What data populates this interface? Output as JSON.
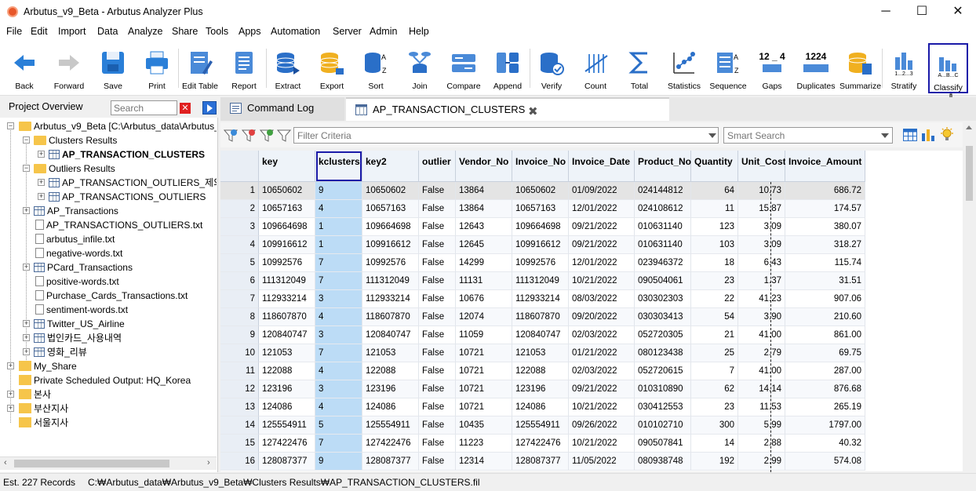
{
  "window": {
    "title": "Arbutus_v9_Beta - Arbutus Analyzer Plus",
    "minimize": "─",
    "maximize": "☐",
    "close": "✕"
  },
  "menu": [
    "File",
    "Edit",
    "Import",
    "Data",
    "Analyze",
    "Share",
    "Tools",
    "Apps",
    "Automation",
    "Server",
    "Admin",
    "Help"
  ],
  "toolbar": {
    "buttons": [
      {
        "label": "Back",
        "icon": "back-arrow-icon"
      },
      {
        "label": "Forward",
        "icon": "forward-arrow-icon"
      },
      {
        "label": "Save",
        "icon": "save-disk-icon"
      },
      {
        "label": "Print",
        "icon": "printer-icon"
      },
      {
        "label": "Edit Table",
        "icon": "edit-table-icon"
      },
      {
        "label": "Report",
        "icon": "report-icon"
      },
      {
        "label": "Extract",
        "icon": "extract-db-icon"
      },
      {
        "label": "Export",
        "icon": "export-db-icon"
      },
      {
        "label": "Sort",
        "icon": "sort-db-icon"
      },
      {
        "label": "Join",
        "icon": "join-icon"
      },
      {
        "label": "Compare",
        "icon": "compare-icon"
      },
      {
        "label": "Append",
        "icon": "append-icon"
      },
      {
        "label": "Verify",
        "icon": "verify-db-icon"
      },
      {
        "label": "Count",
        "icon": "count-icon"
      },
      {
        "label": "Total",
        "icon": "sigma-total-icon"
      },
      {
        "label": "Statistics",
        "icon": "statistics-icon"
      },
      {
        "label": "Sequence",
        "icon": "sequence-icon"
      },
      {
        "label": "Gaps",
        "icon": "gaps-icon"
      },
      {
        "label": "Duplicates",
        "icon": "duplicates-icon"
      },
      {
        "label": "Summarize",
        "icon": "summarize-icon"
      },
      {
        "label": "Stratify",
        "icon": "stratify-icon"
      },
      {
        "label": "Classify",
        "icon": "classify-icon"
      }
    ],
    "gaps_text": "12 _ 4",
    "duplicates_text": "1224",
    "stratify_text": "1...2...3",
    "classify_text": "A...B...C"
  },
  "project": {
    "title": "Project Overview",
    "search_placeholder": "Search",
    "tree": [
      {
        "label": "Arbutus_v9_Beta [C:\\Arbutus_data\\Arbutus_",
        "type": "folder"
      },
      {
        "label": "Clusters Results",
        "type": "folder"
      },
      {
        "label": "AP_TRANSACTION_CLUSTERS",
        "type": "table",
        "bold": true
      },
      {
        "label": "Outliers Results",
        "type": "folder"
      },
      {
        "label": "AP_TRANSACTION_OUTLIERS_제외",
        "type": "table"
      },
      {
        "label": "AP_TRANSACTIONS_OUTLIERS",
        "type": "table"
      },
      {
        "label": "AP_Transactions",
        "type": "table"
      },
      {
        "label": "AP_TRANSACTIONS_OUTLIERS.txt",
        "type": "doc"
      },
      {
        "label": "arbutus_infile.txt",
        "type": "doc"
      },
      {
        "label": "negative-words.txt",
        "type": "doc"
      },
      {
        "label": "PCard_Transactions",
        "type": "table"
      },
      {
        "label": "positive-words.txt",
        "type": "doc"
      },
      {
        "label": "Purchase_Cards_Transactions.txt",
        "type": "doc"
      },
      {
        "label": "sentiment-words.txt",
        "type": "doc"
      },
      {
        "label": "Twitter_US_Airline",
        "type": "table"
      },
      {
        "label": "법인카드_사용내역",
        "type": "table"
      },
      {
        "label": "영화_리뷰",
        "type": "table"
      },
      {
        "label": "My_Share",
        "type": "share"
      },
      {
        "label": "Private Scheduled Output:  HQ_Korea",
        "type": "share"
      },
      {
        "label": "본사",
        "type": "share"
      },
      {
        "label": "부산지사",
        "type": "share"
      },
      {
        "label": "서울지사",
        "type": "share"
      }
    ]
  },
  "tabs": [
    {
      "label": "Command Log"
    },
    {
      "label": "AP_TRANSACTION_CLUSTERS"
    }
  ],
  "filter": {
    "placeholder": "Filter Criteria",
    "smart_placeholder": "Smart Search"
  },
  "table": {
    "columns": [
      "key",
      "kclusters",
      "key2",
      "outlier",
      "Vendor_No",
      "Invoice_No",
      "Invoice_Date",
      "Product_No",
      "Quantity",
      "Unit_Cost",
      "Invoice_Amount"
    ],
    "rows": [
      [
        "1",
        "10650602",
        "9",
        "10650602",
        "False",
        "13864",
        "10650602",
        "01/09/2022",
        "024144812",
        "64",
        "10.73",
        "686.72"
      ],
      [
        "2",
        "10657163",
        "4",
        "10657163",
        "False",
        "13864",
        "10657163",
        "12/01/2022",
        "024108612",
        "11",
        "15.87",
        "174.57"
      ],
      [
        "3",
        "109664698",
        "1",
        "109664698",
        "False",
        "12643",
        "109664698",
        "09/21/2022",
        "010631140",
        "123",
        "3.09",
        "380.07"
      ],
      [
        "4",
        "109916612",
        "1",
        "109916612",
        "False",
        "12645",
        "109916612",
        "09/21/2022",
        "010631140",
        "103",
        "3.09",
        "318.27"
      ],
      [
        "5",
        "10992576",
        "7",
        "10992576",
        "False",
        "14299",
        "10992576",
        "12/01/2022",
        "023946372",
        "18",
        "6.43",
        "115.74"
      ],
      [
        "6",
        "111312049",
        "7",
        "111312049",
        "False",
        "11131",
        "111312049",
        "10/21/2022",
        "090504061",
        "23",
        "1.37",
        "31.51"
      ],
      [
        "7",
        "112933214",
        "3",
        "112933214",
        "False",
        "10676",
        "112933214",
        "08/03/2022",
        "030302303",
        "22",
        "41.23",
        "907.06"
      ],
      [
        "8",
        "118607870",
        "4",
        "118607870",
        "False",
        "12074",
        "118607870",
        "09/20/2022",
        "030303413",
        "54",
        "3.90",
        "210.60"
      ],
      [
        "9",
        "120840747",
        "3",
        "120840747",
        "False",
        "11059",
        "120840747",
        "02/03/2022",
        "052720305",
        "21",
        "41.00",
        "861.00"
      ],
      [
        "10",
        "121053",
        "7",
        "121053",
        "False",
        "10721",
        "121053",
        "01/21/2022",
        "080123438",
        "25",
        "2.79",
        "69.75"
      ],
      [
        "11",
        "122088",
        "4",
        "122088",
        "False",
        "10721",
        "122088",
        "02/03/2022",
        "052720615",
        "7",
        "41.00",
        "287.00"
      ],
      [
        "12",
        "123196",
        "3",
        "123196",
        "False",
        "10721",
        "123196",
        "09/21/2022",
        "010310890",
        "62",
        "14.14",
        "876.68"
      ],
      [
        "13",
        "124086",
        "4",
        "124086",
        "False",
        "10721",
        "124086",
        "10/21/2022",
        "030412553",
        "23",
        "11.53",
        "265.19"
      ],
      [
        "14",
        "125554911",
        "5",
        "125554911",
        "False",
        "10435",
        "125554911",
        "09/26/2022",
        "010102710",
        "300",
        "5.99",
        "1797.00"
      ],
      [
        "15",
        "127422476",
        "7",
        "127422476",
        "False",
        "11223",
        "127422476",
        "10/21/2022",
        "090507841",
        "14",
        "2.88",
        "40.32"
      ],
      [
        "16",
        "128087377",
        "9",
        "128087377",
        "False",
        "12314",
        "128087377",
        "11/05/2022",
        "080938748",
        "192",
        "2.99",
        "574.08"
      ]
    ]
  },
  "status": {
    "records": "Est. 227 Records",
    "path": "C:₩Arbutus_data₩Arbutus_v9_Beta₩Clusters Results₩AP_TRANSACTION_CLUSTERS.fil"
  },
  "colors": {
    "accent": "#1a1aa8",
    "highlight_column": "#bcdcf6",
    "brand": "#e8572a"
  }
}
